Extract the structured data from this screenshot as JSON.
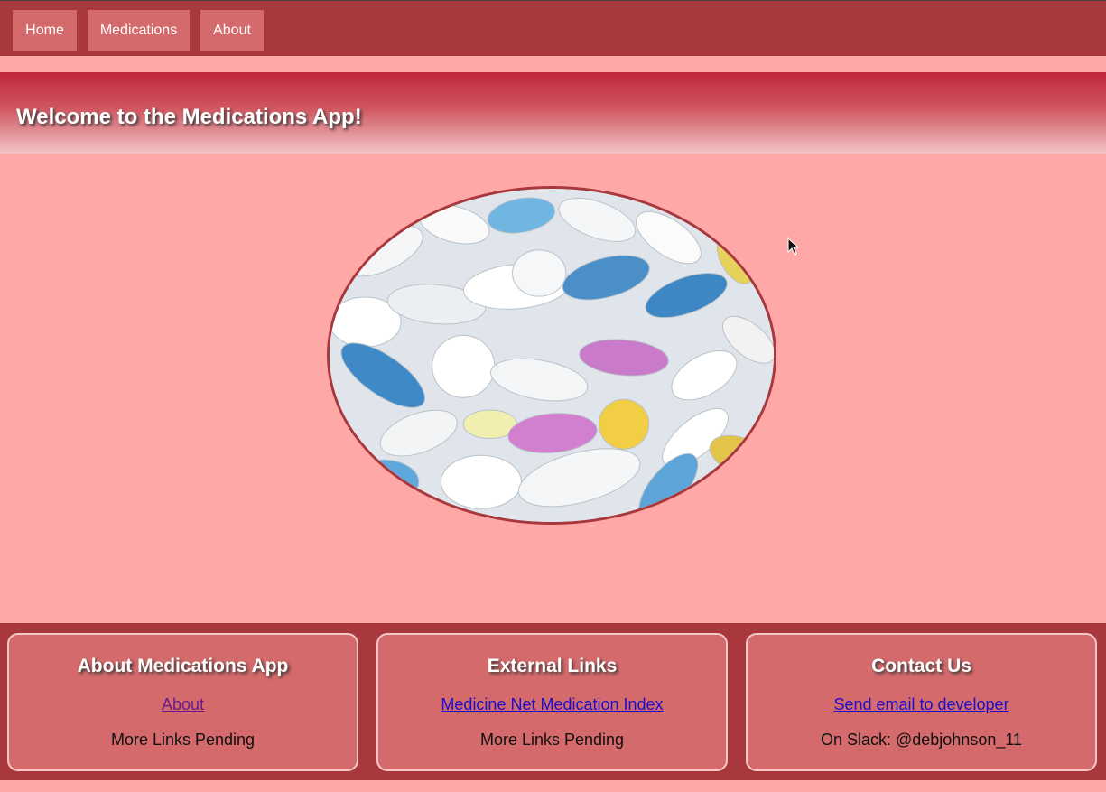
{
  "nav": {
    "items": [
      {
        "label": "Home"
      },
      {
        "label": "Medications"
      },
      {
        "label": "About"
      }
    ]
  },
  "banner": {
    "title": "Welcome to the Medications App!"
  },
  "hero": {
    "image": "pills-photo"
  },
  "footer": {
    "boxes": [
      {
        "title": "About Medications App",
        "link": "About",
        "text": "More Links Pending"
      },
      {
        "title": "External Links",
        "link": "Medicine Net Medication Index",
        "text": "More Links Pending"
      },
      {
        "title": "Contact Us",
        "link": "Send email to developer",
        "text": "On Slack: @debjohnson_11"
      }
    ]
  },
  "colors": {
    "nav_bg": "#a8383c",
    "nav_button": "#d46a6b",
    "page_bg": "#ffa8a8",
    "footer_box": "#d46a6b"
  }
}
